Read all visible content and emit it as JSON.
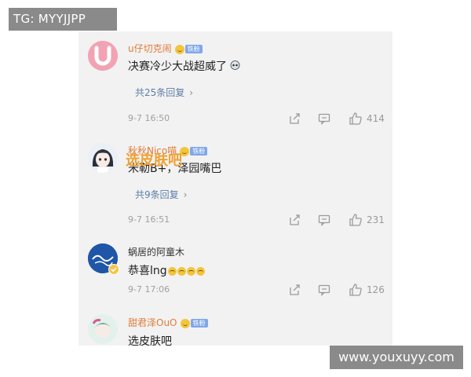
{
  "watermarks": {
    "top_left": "TG: MYYJJPP",
    "bottom_right": "www.youxuyy.com"
  },
  "sticker_text": "选皮肤吧",
  "comments": [
    {
      "username": "u仔切克闹",
      "badge_label": "铁粉",
      "content": "决赛冷少大战超威了",
      "reply_link": "共25条回复",
      "timestamp": "9-7 16:50",
      "likes": "414"
    },
    {
      "username": "秋秋Nico喵",
      "badge_label": "铁粉",
      "content": "米勒B+，泽园嘴巴",
      "reply_link": "共9条回复",
      "timestamp": "9-7 16:51",
      "likes": "231"
    },
    {
      "username": "蜗居的阿童木",
      "content": "恭喜lng",
      "timestamp": "9-7 17:06",
      "likes": "126"
    },
    {
      "username": "甜君泽OuO",
      "badge_label": "铁粉",
      "content": "选皮肤吧"
    }
  ],
  "icons": [
    "share-icon",
    "comment-icon",
    "like-icon",
    "chevron-right-icon"
  ],
  "colors": {
    "username": "#e07b39",
    "reply_link": "#5d7fa6",
    "fan_badge": "#7fa7e8",
    "panel_bg": "#f2f2f2",
    "sticker": "#f0a030"
  }
}
